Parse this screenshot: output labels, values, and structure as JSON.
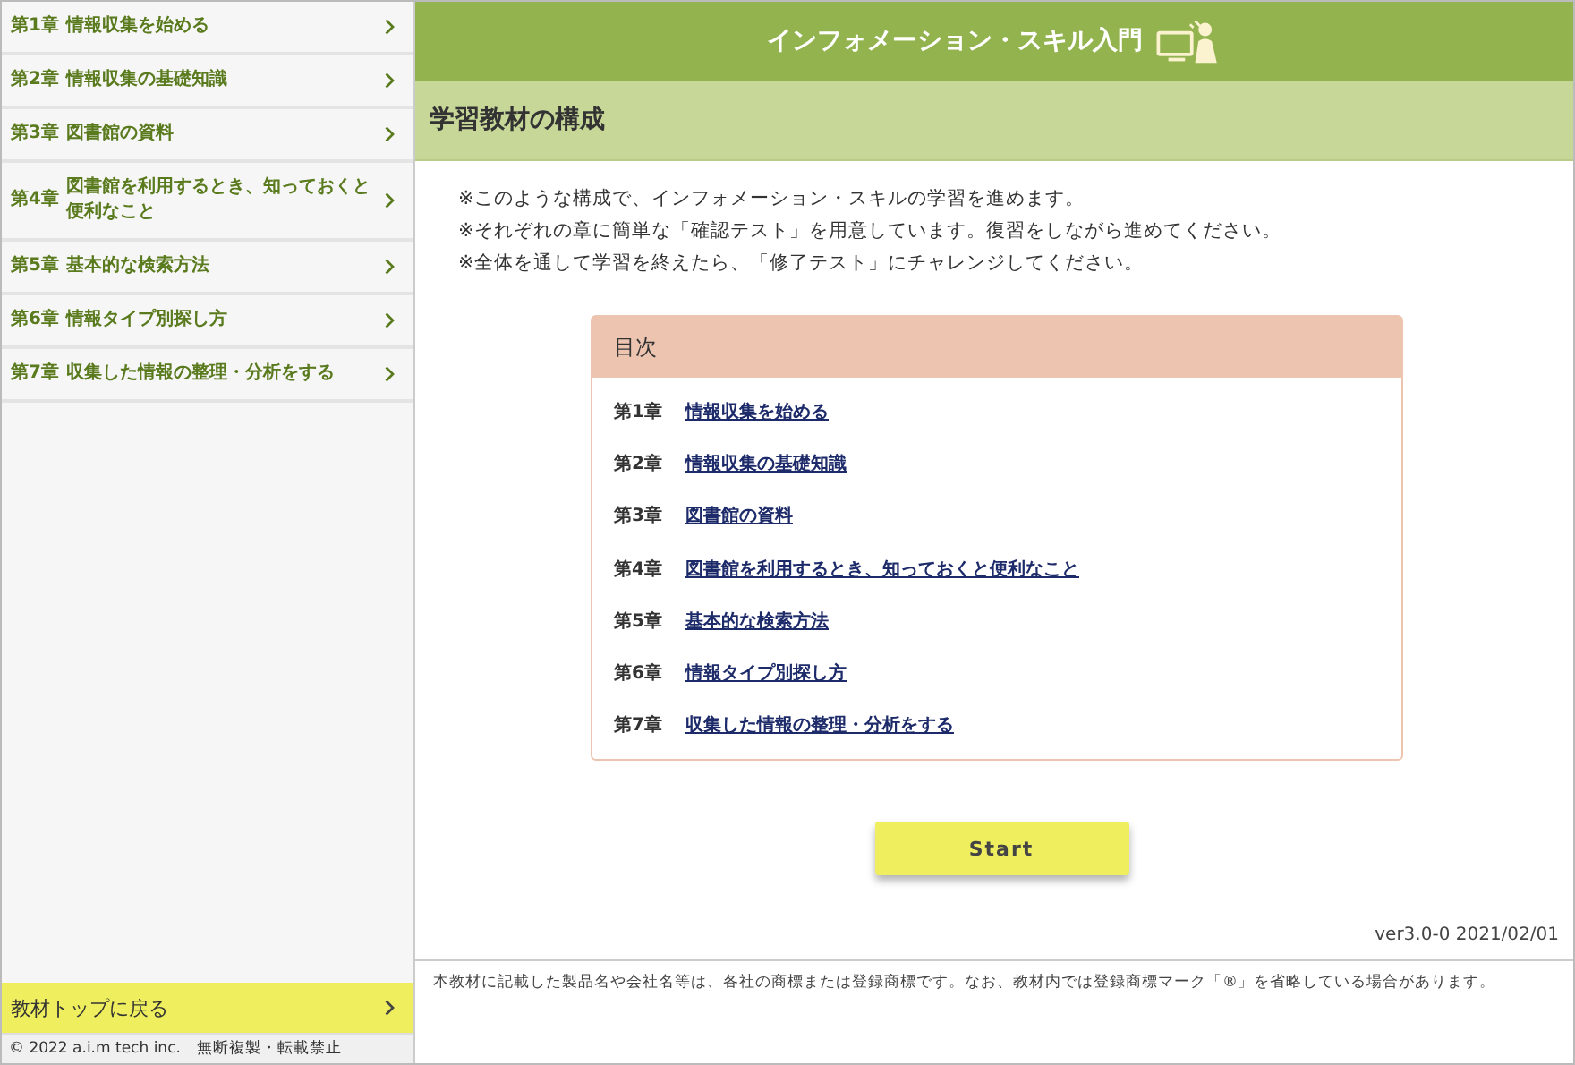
{
  "sidebar": {
    "items": [
      {
        "chapter": "第1章",
        "title": "情報収集を始める"
      },
      {
        "chapter": "第2章",
        "title": "情報収集の基礎知識"
      },
      {
        "chapter": "第3章",
        "title": "図書館の資料"
      },
      {
        "chapter": "第4章",
        "title": "図書館を利用するとき、知っておくと便利なこと"
      },
      {
        "chapter": "第5章",
        "title": "基本的な検索方法"
      },
      {
        "chapter": "第6章",
        "title": "情報タイプ別探し方"
      },
      {
        "chapter": "第7章",
        "title": "収集した情報の整理・分析をする"
      }
    ],
    "back_link": "教材トップに戻る",
    "copyright": "© 2022 a.i.m tech inc.　無断複製・転載禁止"
  },
  "header": {
    "title": "インフォメーション・スキル入門"
  },
  "page_title": "学習教材の構成",
  "notes": [
    "※このような構成で、インフォメーション・スキルの学習を進めます。",
    "※それぞれの章に簡単な「確認テスト」を用意しています。復習をしながら進めてください。",
    "※全体を通して学習を終えたら、「修了テスト」にチャレンジしてください。"
  ],
  "toc": {
    "title": "目次",
    "items": [
      {
        "chapter": "第1章",
        "title": "情報収集を始める"
      },
      {
        "chapter": "第2章",
        "title": "情報収集の基礎知識"
      },
      {
        "chapter": "第3章",
        "title": "図書館の資料"
      },
      {
        "chapter": "第4章",
        "title": "図書館を利用するとき、知っておくと便利なこと"
      },
      {
        "chapter": "第5章",
        "title": "基本的な検索方法"
      },
      {
        "chapter": "第6章",
        "title": "情報タイプ別探し方"
      },
      {
        "chapter": "第7章",
        "title": "収集した情報の整理・分析をする"
      }
    ]
  },
  "start_button": "Start",
  "version": "ver3.0-0 2021/02/01",
  "footer_note": "本教材に記載した製品名や会社名等は、各社の商標または登録商標です。なお、教材内では登録商標マーク「®」を省略している場合があります。"
}
